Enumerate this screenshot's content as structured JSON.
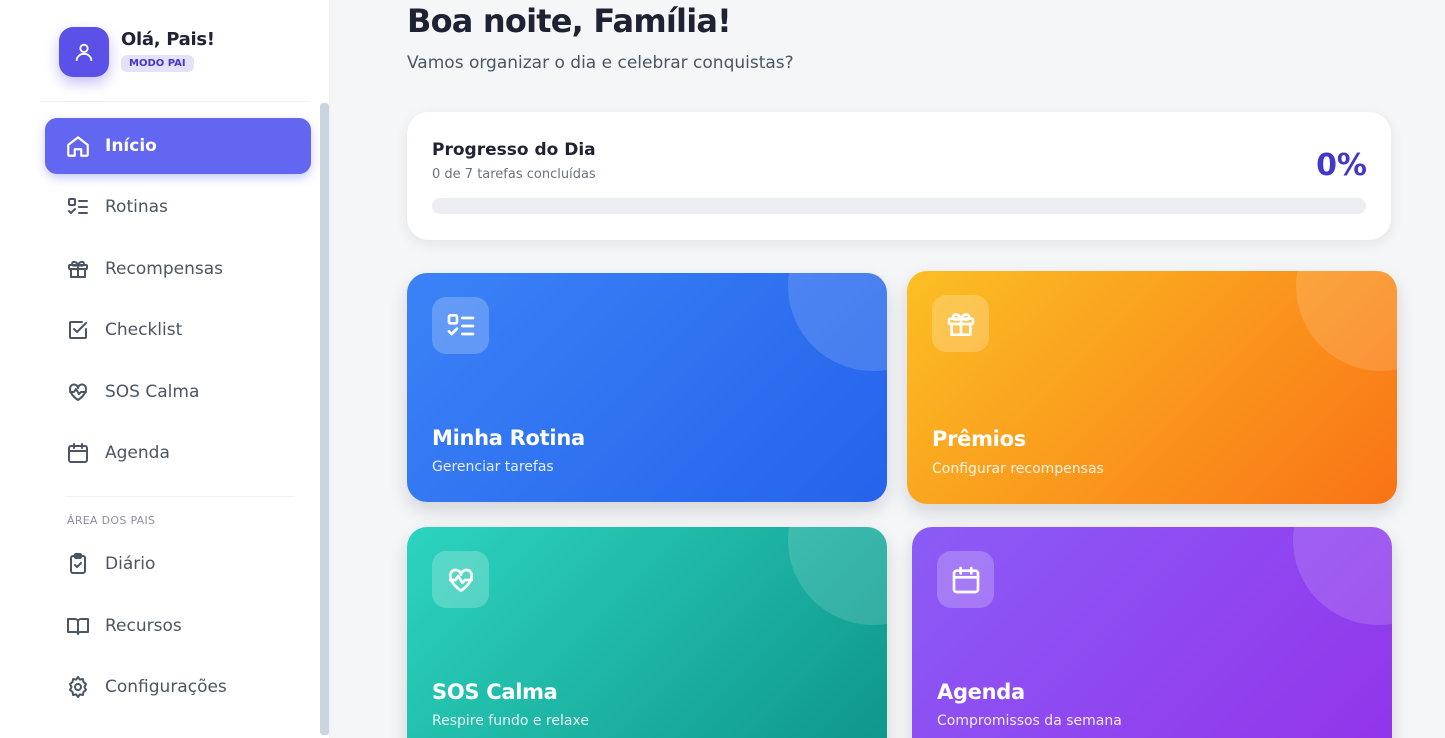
{
  "profile": {
    "greeting": "Olá, Pais!",
    "mode_badge": "MODO PAI"
  },
  "sidebar": {
    "items": [
      {
        "label": "Início",
        "icon": "home-icon",
        "active": true
      },
      {
        "label": "Rotinas",
        "icon": "list-check-icon"
      },
      {
        "label": "Recompensas",
        "icon": "gift-icon"
      },
      {
        "label": "Checklist",
        "icon": "checkbox-icon"
      },
      {
        "label": "SOS Calma",
        "icon": "heart-pulse-icon"
      },
      {
        "label": "Agenda",
        "icon": "calendar-icon"
      }
    ],
    "section_label": "ÁREA DOS PAIS",
    "parent_items": [
      {
        "label": "Diário",
        "icon": "clipboard-check-icon"
      },
      {
        "label": "Recursos",
        "icon": "book-open-icon"
      },
      {
        "label": "Configurações",
        "icon": "gear-icon"
      }
    ]
  },
  "main": {
    "title": "Boa noite, Família!",
    "subtitle": "Vamos organizar o dia e celebrar conquistas?",
    "progress": {
      "title": "Progresso do Dia",
      "summary": "0 de 7 tarefas concluídas",
      "percent_label": "0%",
      "value": 0
    },
    "tiles": [
      {
        "title": "Minha Rotina",
        "subtitle": "Gerenciar tarefas",
        "icon": "list-check-icon",
        "color": "#2563eb"
      },
      {
        "title": "Prêmios",
        "subtitle": "Configurar recompensas",
        "icon": "gift-icon",
        "color": "#f97316"
      },
      {
        "title": "SOS Calma",
        "subtitle": "Respire fundo e relaxe",
        "icon": "heart-pulse-icon",
        "color": "#14b8a6"
      },
      {
        "title": "Agenda",
        "subtitle": "Compromissos da semana",
        "icon": "calendar-icon",
        "color": "#9333ea"
      }
    ]
  },
  "colors": {
    "accent": "#6366f1",
    "accent_dark": "#4338ca"
  }
}
